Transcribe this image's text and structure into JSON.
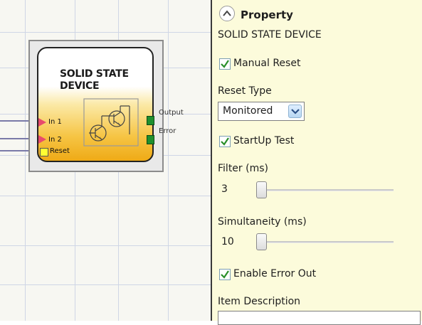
{
  "block": {
    "title": "SOLID STATE DEVICE",
    "inputs": [
      "In 1",
      "In 2",
      "Reset"
    ],
    "outputs": [
      "Output",
      "Error"
    ]
  },
  "colors": {
    "canvas_background": "#f7f7f2",
    "block_gradient_bottom": "#efaa16",
    "input_arrow": "#e84b6c",
    "reset_square": "#ffff33",
    "output_square": "#1e8f2e",
    "panel_background": "#fcfbdb",
    "checkbox_check": "#2a8f2a"
  },
  "panel": {
    "header": "Property",
    "device_name": "SOLID STATE DEVICE",
    "manual_reset": {
      "label": "Manual Reset",
      "checked": true
    },
    "reset_type": {
      "label": "Reset Type",
      "value": "Monitored"
    },
    "startup_test": {
      "label": "StartUp Test",
      "checked": true
    },
    "filter": {
      "label": "Filter (ms)",
      "value": "3",
      "slider_position": 0.0
    },
    "simultaneity": {
      "label": "Simultaneity (ms)",
      "value": "10",
      "slider_position": 0.0
    },
    "enable_error_out": {
      "label": "Enable Error Out",
      "checked": true
    },
    "item_description": {
      "label": "Item Description",
      "value": ""
    }
  }
}
